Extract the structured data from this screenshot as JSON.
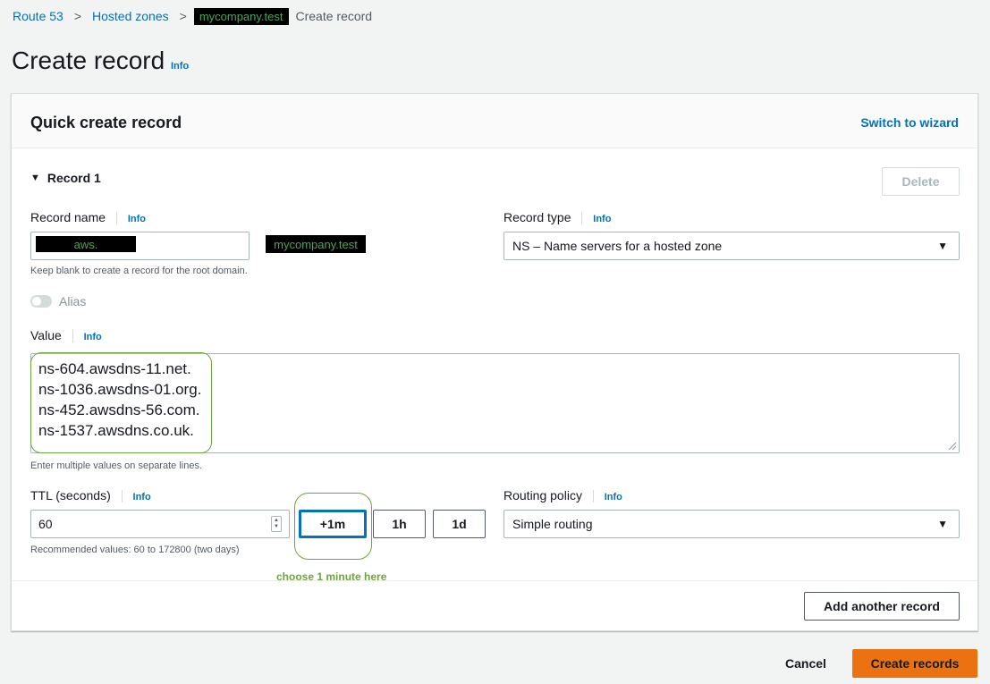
{
  "breadcrumb": {
    "items": [
      "Route 53",
      "Hosted zones"
    ],
    "zone": "mycompany.test",
    "current": "Create record",
    "separator": ">"
  },
  "page": {
    "title": "Create record",
    "info": "Info"
  },
  "panel": {
    "title": "Quick create record",
    "switch_wizard": "Switch to wizard"
  },
  "record": {
    "heading": "Record 1",
    "delete_label": "Delete",
    "record_name": {
      "label": "Record name",
      "info": "Info",
      "value": "aws.",
      "domain_suffix": "mycompany.test",
      "hint": "Keep blank to create a record for the root domain."
    },
    "record_type": {
      "label": "Record type",
      "info": "Info",
      "value": "NS – Name servers for a hosted zone"
    },
    "alias": {
      "label": "Alias",
      "enabled": false
    },
    "value": {
      "label": "Value",
      "info": "Info",
      "lines": [
        "ns-604.awsdns-11.net.",
        "ns-1036.awsdns-01.org.",
        "ns-452.awsdns-56.com.",
        "ns-1537.awsdns.co.uk."
      ],
      "hint": "Enter multiple values on separate lines."
    },
    "ttl": {
      "label": "TTL (seconds)",
      "info": "Info",
      "value": "60",
      "buttons": [
        "+1m",
        "1h",
        "1d"
      ],
      "hint": "Recommended values: 60 to 172800 (two days)",
      "annotation": "choose 1 minute here"
    },
    "routing_policy": {
      "label": "Routing policy",
      "info": "Info",
      "value": "Simple routing"
    }
  },
  "add_record_label": "Add another record",
  "footer": {
    "cancel": "Cancel",
    "create": "Create records"
  },
  "colors": {
    "accent": "#0073bb",
    "primary_button": "#ec7211",
    "annotation": "#6fa43a"
  }
}
